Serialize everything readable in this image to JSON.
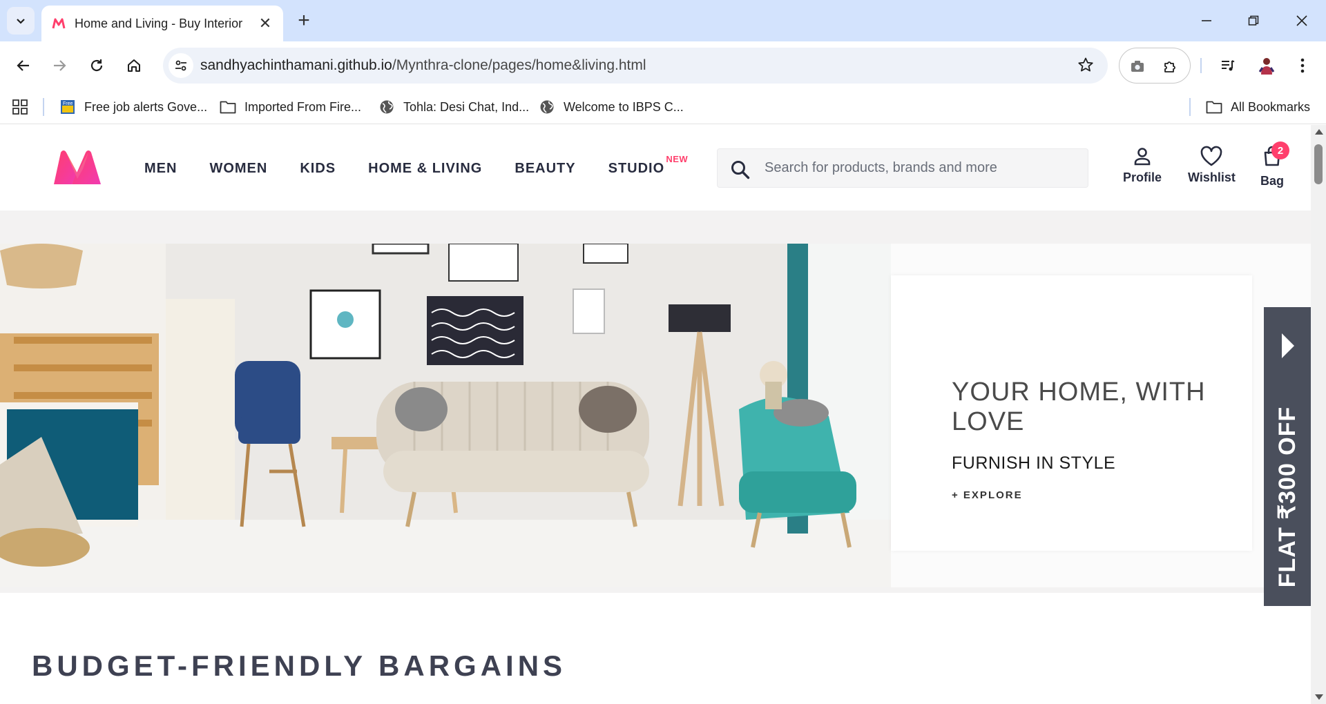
{
  "browser": {
    "tab_title": "Home and Living - Buy Interior",
    "url_host": "sandhyachinthamani.github.io",
    "url_path": "/Mynthra-clone/pages/home&living.html",
    "bookmarks": [
      {
        "label": "Free job alerts Gove...",
        "icon": "job-alert-favicon"
      },
      {
        "label": "Imported From Fire...",
        "icon": "folder-icon"
      },
      {
        "label": "Tohla: Desi Chat, Ind...",
        "icon": "globe-icon"
      },
      {
        "label": "Welcome to IBPS C...",
        "icon": "globe-icon"
      }
    ],
    "all_bookmarks_label": "All Bookmarks"
  },
  "header": {
    "nav": [
      "MEN",
      "WOMEN",
      "KIDS",
      "HOME & LIVING",
      "BEAUTY",
      "STUDIO"
    ],
    "studio_tag": "NEW",
    "search_placeholder": "Search for products, brands and more",
    "profile_label": "Profile",
    "wishlist_label": "Wishlist",
    "bag_label": "Bag",
    "bag_count": "2"
  },
  "hero": {
    "title": "YOUR HOME, WITH LOVE",
    "subtitle": "FURNISH IN STYLE",
    "cta": "+ EXPLORE",
    "offer": "FLAT ₹300 OFF"
  },
  "sections": {
    "budget_title": "BUDGET-FRIENDLY BARGAINS"
  },
  "colors": {
    "brand_pink": "#ff3f6c",
    "text_dark": "#282c3f",
    "chrome_blue": "#d3e3fd"
  }
}
